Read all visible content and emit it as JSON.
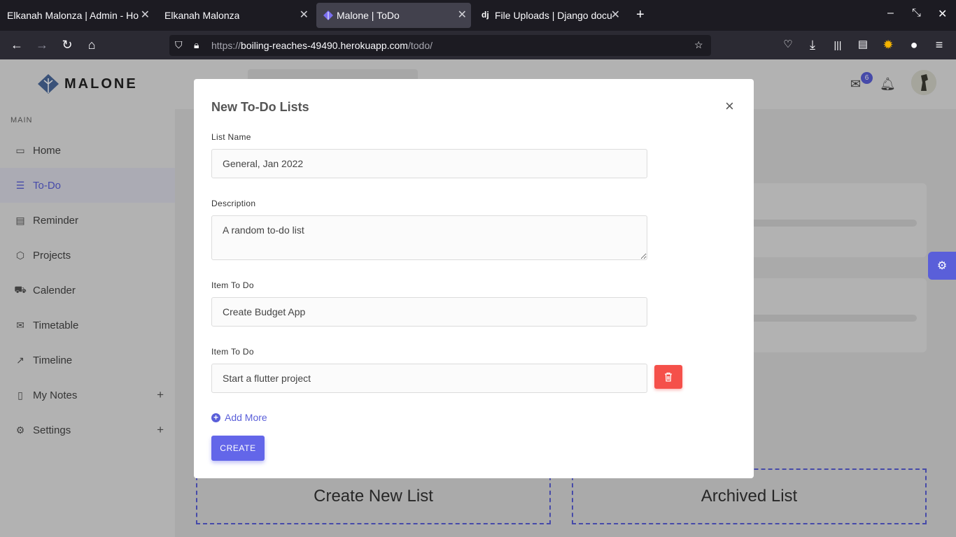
{
  "browser": {
    "tabs": [
      {
        "title": "Elkanah Malonza | Admin - Ho",
        "active": false
      },
      {
        "title": "Elkanah Malonza",
        "active": false
      },
      {
        "title": "Malone | ToDo",
        "active": true
      },
      {
        "title": "File Uploads | Django docu",
        "active": false
      }
    ],
    "favicon_django": "dj",
    "url_prefix": "https://",
    "url_host": "boiling-reaches-49490.herokuapp.com",
    "url_path": "/todo/"
  },
  "app": {
    "logo_text": "MALONE",
    "notification_count": "6",
    "sidebar": {
      "section": "MAIN",
      "items": [
        {
          "label": "Home",
          "icon": "monitor-icon"
        },
        {
          "label": "To-Do",
          "icon": "list-icon"
        },
        {
          "label": "Reminder",
          "icon": "archive-icon"
        },
        {
          "label": "Projects",
          "icon": "codepen-icon"
        },
        {
          "label": "Calender",
          "icon": "truck-icon"
        },
        {
          "label": "Timetable",
          "icon": "mail-icon"
        },
        {
          "label": "Timeline",
          "icon": "trending-up-icon"
        },
        {
          "label": "My Notes",
          "icon": "book-icon"
        },
        {
          "label": "Settings",
          "icon": "settings-icon"
        }
      ],
      "plus": "+"
    },
    "create_new_list": "Create New List",
    "archived_list": "Archived List"
  },
  "modal": {
    "title": "New To-Do Lists",
    "close": "×",
    "list_name_label": "List Name",
    "list_name_value": "General, Jan 2022",
    "description_label": "Description",
    "description_value": "A random to-do list",
    "item_label": "Item To Do",
    "item1_value": "Create Budget App",
    "item2_value": "Start a flutter project",
    "add_more": "Add More",
    "create": "CREATE"
  },
  "colors": {
    "accent": "#5a5fd9",
    "danger": "#f5504a",
    "chrome_dark": "#1c1b22"
  }
}
